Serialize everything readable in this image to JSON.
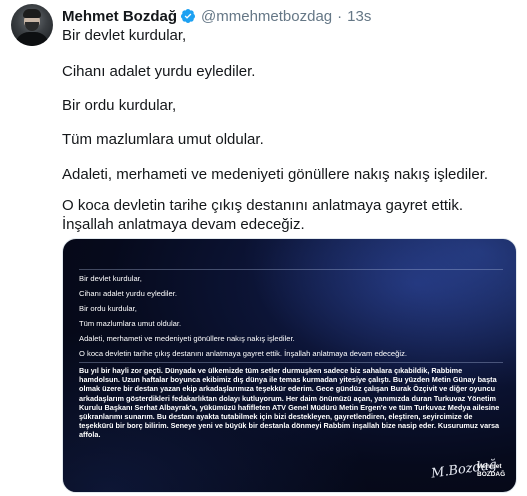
{
  "author": {
    "name": "Mehmet Bozdağ",
    "handle": "@mmehmetbozdag",
    "separator": "·",
    "time": "13s"
  },
  "tweet_lines": [
    "Bir devlet kurdular,",
    "Cihanı adalet yurdu eylediler.",
    "Bir ordu kurdular,",
    "Tüm mazlumlara umut oldular.",
    "Adaleti, merhameti ve medeniyeti gönüllere nakış nakış işlediler.",
    "O koca devletin tarihe çıkış destanını anlatmaya gayret ettik. İnşallah anlatmaya devam edeceğiz."
  ],
  "media": {
    "lines": [
      "Bir devlet kurdular,",
      "Cihanı adalet yurdu eylediler.",
      "Bir ordu kurdular,",
      "Tüm mazlumlara umut oldular.",
      "Adaleti, merhameti ve medeniyeti gönüllere nakış nakış işlediler.",
      "O koca devletin tarihe çıkış destanını anlatmaya gayret ettik. İnşallah anlatmaya devam edeceğiz."
    ],
    "paragraph": "Bu yıl bir hayli zor geçti. Dünyada ve ülkemizde tüm setler durmuşken sadece biz sahalara çıkabildik, Rabbime hamdolsun. Uzun haftalar boyunca ekibimiz dış dünya ile temas kurmadan yitesiye çalıştı. Bu yüzden Metin Günay başta olmak üzere bir destan yazan ekip arkadaşlarımıza teşekkür ederim. Gece gündüz çalışan Burak Özçivit ve diğer oyuncu arkadaşlarım gösterdikleri fedakarlıktan dolayı kutluyorum. Her daim önümüzü açan, yanımızda duran Turkuvaz Yönetim Kurulu Başkanı Serhat Albayrak'a, yükümüzü hafifleten ATV Genel Müdürü Metin Ergen'e ve tüm Turkuvaz Medya ailesine şükranlarımı sunarım. Bu destanı ayakta tutabilmek için bizi destekleyen, gayretlendiren, eleştiren, seyircimize de teşekkürü bir borç bilirim. Seneye yeni ve büyük bir destanla dönmeyi Rabbim inşallah bize nasip eder. Kusurumuz varsa affola.",
    "signature": "M.Bozdağ",
    "signature_name_1": "Mehmet",
    "signature_name_2": "BOZDAĞ"
  },
  "colors": {
    "verified": "#1da1f2",
    "secondary_text": "#657786",
    "primary_text": "#14171a"
  },
  "icons": {
    "verified": "verified-badge-icon"
  }
}
